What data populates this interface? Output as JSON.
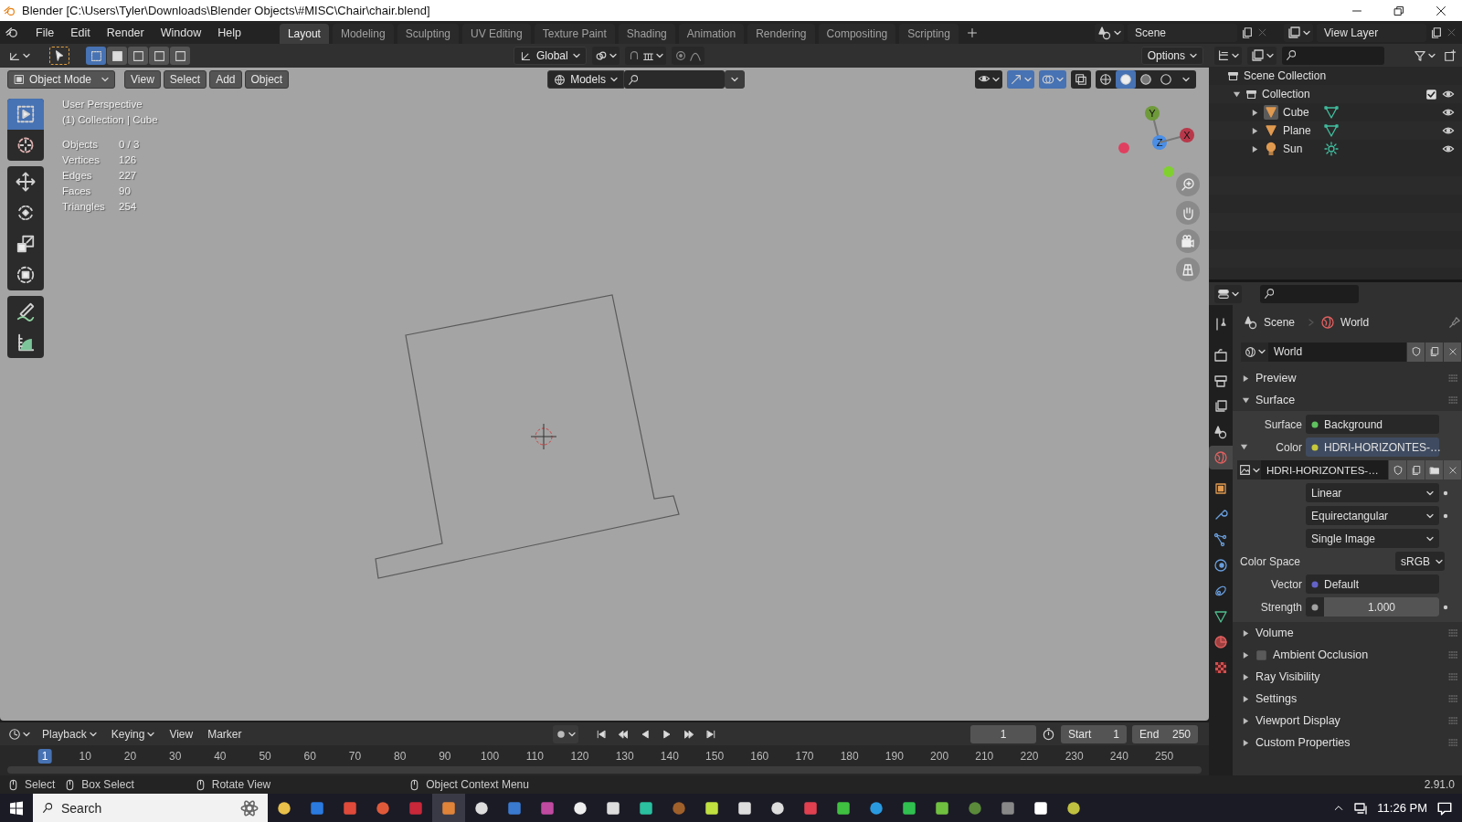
{
  "window": {
    "title": "Blender [C:\\Users\\Tyler\\Downloads\\Blender Objects\\#MISC\\Chair\\chair.blend]"
  },
  "menu": [
    "File",
    "Edit",
    "Render",
    "Window",
    "Help"
  ],
  "workspaces": [
    {
      "label": "Layout",
      "selected": true
    },
    {
      "label": "Modeling",
      "selected": false
    },
    {
      "label": "Sculpting",
      "selected": false
    },
    {
      "label": "UV Editing",
      "selected": false
    },
    {
      "label": "Texture Paint",
      "selected": false
    },
    {
      "label": "Shading",
      "selected": false
    },
    {
      "label": "Animation",
      "selected": false
    },
    {
      "label": "Rendering",
      "selected": false
    },
    {
      "label": "Compositing",
      "selected": false
    },
    {
      "label": "Scripting",
      "selected": false
    }
  ],
  "scene": "Scene",
  "view_layer": "View Layer",
  "tool_header": {
    "orientation": "Global",
    "options": "Options",
    "select_modes": [
      {
        "selected": true
      },
      {
        "selected": false
      },
      {
        "selected": false
      },
      {
        "selected": false
      },
      {
        "selected": false
      }
    ]
  },
  "viewport_header": {
    "mode": "Object Mode",
    "menus": [
      "View",
      "Select",
      "Add",
      "Object"
    ],
    "collection": "Models",
    "gizmos_on": true,
    "overlays_on": true,
    "shading_modes": [
      {
        "selected": false
      },
      {
        "selected": true
      },
      {
        "selected": false
      },
      {
        "selected": false
      }
    ]
  },
  "tools": [
    [
      {
        "kind": "select",
        "selected": true
      },
      {
        "kind": "cursor",
        "selected": false
      }
    ],
    [
      {
        "kind": "move",
        "selected": false
      },
      {
        "kind": "rotate",
        "selected": false
      },
      {
        "kind": "scale",
        "selected": false
      },
      {
        "kind": "transform",
        "selected": false
      }
    ],
    [
      {
        "kind": "annotate",
        "selected": false
      },
      {
        "kind": "measure",
        "selected": false
      }
    ]
  ],
  "viewport_info": {
    "view": "User Perspective",
    "context": "(1) Collection | Cube",
    "stats": [
      {
        "label": "Objects",
        "value": "0 / 3"
      },
      {
        "label": "Vertices",
        "value": "126"
      },
      {
        "label": "Edges",
        "value": "227"
      },
      {
        "label": "Faces",
        "value": "90"
      },
      {
        "label": "Triangles",
        "value": "254"
      }
    ]
  },
  "gizmo": [
    {
      "label": "Y",
      "color": "#6f9a3a"
    },
    {
      "label": "Z",
      "color": "#4a8ee6"
    },
    {
      "label": "X",
      "color": "#b8384a"
    }
  ],
  "outliner": {
    "root": "Scene Collection",
    "collections": [
      {
        "label": "Collection",
        "expanded": true,
        "checked": true,
        "children": [
          {
            "label": "Cube",
            "kind": "mesh",
            "expanded": false,
            "selected": true
          },
          {
            "label": "Plane",
            "kind": "mesh",
            "expanded": false,
            "selected": false
          },
          {
            "label": "Sun",
            "kind": "light",
            "expanded": false,
            "selected": false
          }
        ]
      }
    ]
  },
  "properties": {
    "tabs": [
      {
        "kind": "tool",
        "selected": false
      },
      {
        "kind": "render",
        "selected": false
      },
      {
        "kind": "output",
        "selected": false
      },
      {
        "kind": "view_layer",
        "selected": false
      },
      {
        "kind": "scene",
        "selected": false
      },
      {
        "kind": "world",
        "selected": true
      },
      {
        "kind": "object",
        "selected": false
      },
      {
        "kind": "modifiers",
        "selected": false
      },
      {
        "kind": "particles",
        "selected": false
      },
      {
        "kind": "physics",
        "selected": false
      },
      {
        "kind": "constraints",
        "selected": false
      },
      {
        "kind": "data",
        "selected": false
      },
      {
        "kind": "material",
        "selected": false
      },
      {
        "kind": "texture",
        "selected": false
      }
    ],
    "breadcrumb": [
      "Scene",
      "World"
    ],
    "datablock": "World",
    "panels": [
      {
        "label": "Preview",
        "expanded": false
      },
      {
        "label": "Surface",
        "expanded": true,
        "rows": [
          {
            "kind": "socket",
            "label": "Surface",
            "value": "Background",
            "color": "#5fc25f"
          },
          {
            "kind": "socket",
            "label": "Color",
            "value": "HDRI-HORIZONTES-…",
            "color": "#c7c73a",
            "expanded": true
          },
          {
            "kind": "image",
            "value": "HDRI-HORIZONTES-…"
          },
          {
            "kind": "dropdown",
            "value": "Linear"
          },
          {
            "kind": "dropdown",
            "value": "Equirectangular"
          },
          {
            "kind": "dropdown",
            "value": "Single Image"
          },
          {
            "kind": "inline_dropdown",
            "label": "Color Space",
            "value": "sRGB"
          },
          {
            "kind": "socket",
            "label": "Vector",
            "value": "Default",
            "color": "#6363c7"
          },
          {
            "kind": "number",
            "label": "Strength",
            "value": "1.000",
            "color": "#a1a1a1"
          }
        ]
      },
      {
        "label": "Volume",
        "expanded": false
      },
      {
        "label": "Ambient Occlusion",
        "expanded": false,
        "checked": false
      },
      {
        "label": "Ray Visibility",
        "expanded": false
      },
      {
        "label": "Settings",
        "expanded": false
      },
      {
        "label": "Viewport Display",
        "expanded": false
      },
      {
        "label": "Custom Properties",
        "expanded": false
      }
    ]
  },
  "timeline": {
    "menus": [
      "Playback",
      "Keying",
      "View",
      "Marker"
    ],
    "current_frame": "1",
    "start_label": "Start",
    "start": "1",
    "end_label": "End",
    "end": "250",
    "ticks": [
      {
        "label": "1",
        "selected": true
      },
      {
        "label": "10",
        "selected": false
      },
      {
        "label": "20",
        "selected": false
      },
      {
        "label": "30",
        "selected": false
      },
      {
        "label": "40",
        "selected": false
      },
      {
        "label": "50",
        "selected": false
      },
      {
        "label": "60",
        "selected": false
      },
      {
        "label": "70",
        "selected": false
      },
      {
        "label": "80",
        "selected": false
      },
      {
        "label": "90",
        "selected": false
      },
      {
        "label": "100",
        "selected": false
      },
      {
        "label": "110",
        "selected": false
      },
      {
        "label": "120",
        "selected": false
      },
      {
        "label": "130",
        "selected": false
      },
      {
        "label": "140",
        "selected": false
      },
      {
        "label": "150",
        "selected": false
      },
      {
        "label": "160",
        "selected": false
      },
      {
        "label": "170",
        "selected": false
      },
      {
        "label": "180",
        "selected": false
      },
      {
        "label": "190",
        "selected": false
      },
      {
        "label": "200",
        "selected": false
      },
      {
        "label": "210",
        "selected": false
      },
      {
        "label": "220",
        "selected": false
      },
      {
        "label": "230",
        "selected": false
      },
      {
        "label": "240",
        "selected": false
      },
      {
        "label": "250",
        "selected": false
      }
    ]
  },
  "status_bar": {
    "hints": [
      "Select",
      "Box Select",
      "Rotate View",
      "Object Context Menu"
    ],
    "version": "2.91.0"
  },
  "taskbar": {
    "search": "Search",
    "time": "11:26 PM"
  }
}
